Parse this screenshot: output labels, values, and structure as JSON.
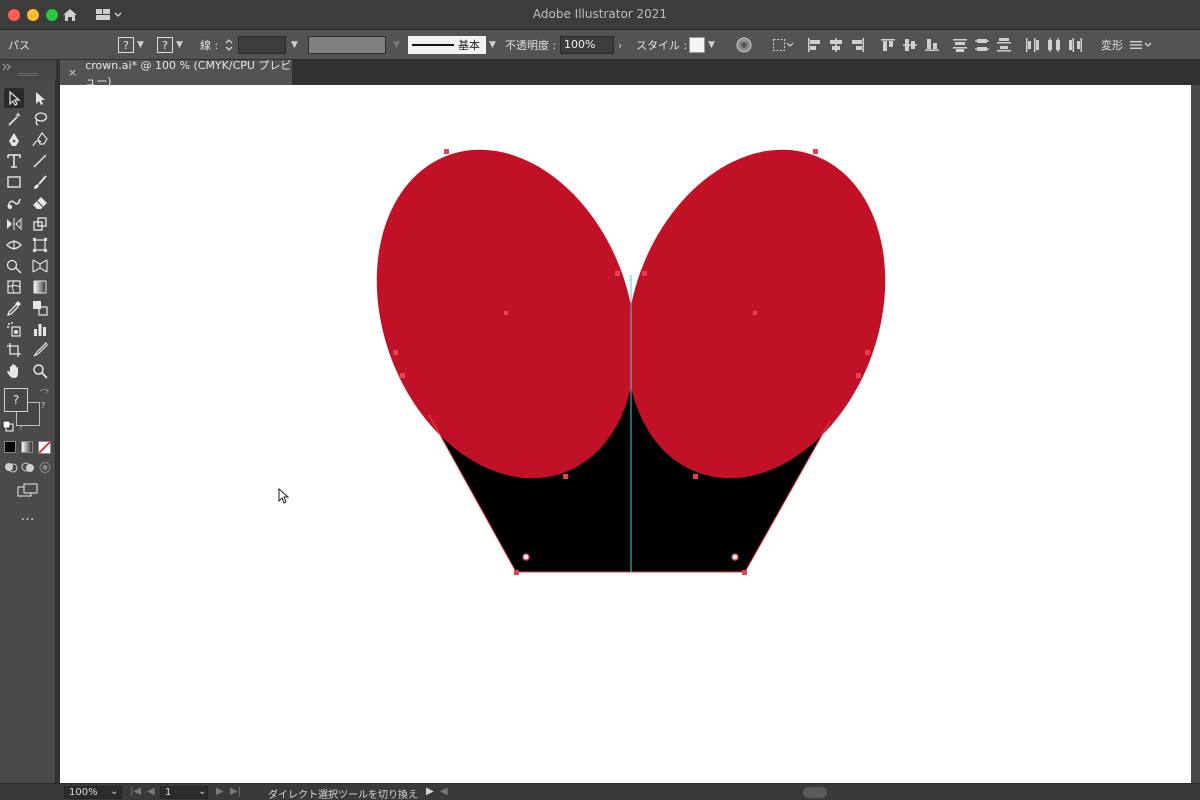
{
  "window": {
    "title": "Adobe Illustrator 2021"
  },
  "control_bar": {
    "object_type": "パス",
    "stroke_label": "線 :",
    "stroke_style": "基本",
    "opacity_label": "不透明度 :",
    "opacity_value": "100%",
    "style_label": "スタイル :",
    "transform_label": "変形"
  },
  "document_tab": {
    "title": "crown.ai* @ 100 % (CMYK/CPU プレビュー)",
    "close_glyph": "×"
  },
  "toolbar": {
    "fill_stroke_unknown": "?",
    "tools": [
      "direct-selection-tool",
      "selection-tool",
      "magic-wand-tool",
      "lasso-tool",
      "pen-tool",
      "curvature-tool",
      "type-tool",
      "line-tool",
      "rectangle-tool",
      "paintbrush-tool",
      "shaper-tool",
      "eraser-tool",
      "reflect-tool",
      "scale-tool",
      "width-tool",
      "free-transform-tool",
      "shape-builder-tool",
      "perspective-grid-tool",
      "mesh-tool",
      "gradient-tool",
      "eyedropper-tool",
      "blend-tool",
      "symbol-sprayer-tool",
      "column-graph-tool",
      "artboard-tool",
      "slice-tool",
      "hand-tool",
      "zoom-tool"
    ]
  },
  "artwork": {
    "left_ellipse_color": "#c01126",
    "right_ellipse_color": "#c01126",
    "base_color": "#000000",
    "selection_color": "#e8424f",
    "guide_color": "#3fd0e0"
  },
  "status_bar": {
    "zoom": "100%",
    "artboard": "1",
    "current_tool": "ダイレクト選択ツールを切り換え"
  }
}
